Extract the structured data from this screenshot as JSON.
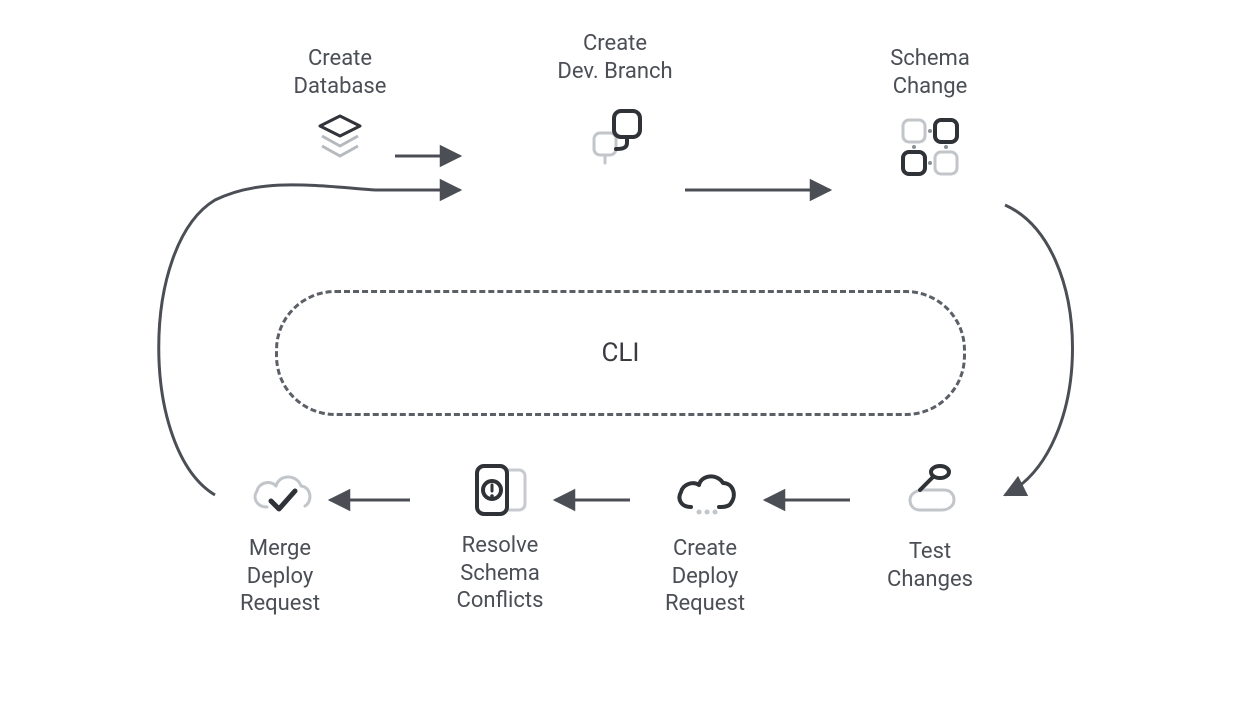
{
  "center": {
    "label": "CLI"
  },
  "nodes": {
    "create_database": {
      "label": "Create\nDatabase",
      "icon": "database-stack-icon"
    },
    "create_dev_branch": {
      "label": "Create\nDev. Branch",
      "icon": "branch-icon"
    },
    "schema_change": {
      "label": "Schema\nChange",
      "icon": "schema-grid-icon"
    },
    "test_changes": {
      "label": "Test\nChanges",
      "icon": "test-stamp-icon"
    },
    "create_deploy_request": {
      "label": "Create\nDeploy\nRequest",
      "icon": "cloud-deploy-icon"
    },
    "resolve_schema_conflicts": {
      "label": "Resolve\nSchema\nConflicts",
      "icon": "conflict-icon"
    },
    "merge_deploy_request": {
      "label": "Merge\nDeploy\nRequest",
      "icon": "cloud-check-icon"
    }
  }
}
